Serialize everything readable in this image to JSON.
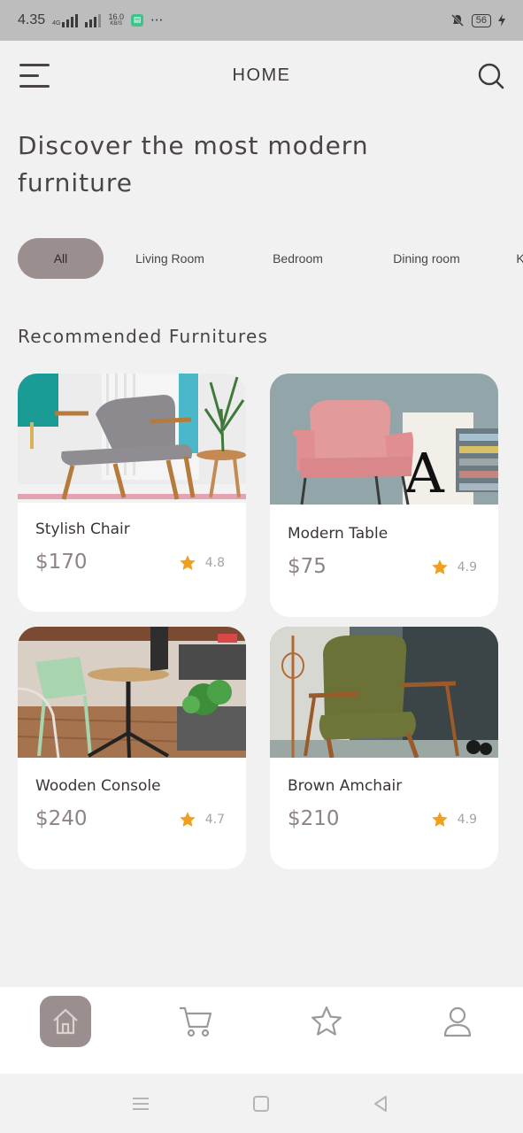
{
  "status_bar": {
    "time": "4.35",
    "network": "4G",
    "speed_value": "16.0",
    "speed_unit": "KB/S",
    "more": "···",
    "battery": "56"
  },
  "header": {
    "title": "HOME",
    "menu_icon": "hamburger-menu-icon",
    "search_icon": "search-icon"
  },
  "headline": "Discover the most modern furniture",
  "categories": [
    {
      "label": "All",
      "active": true
    },
    {
      "label": "Living Room",
      "active": false
    },
    {
      "label": "Bedroom",
      "active": false
    },
    {
      "label": "Dining room",
      "active": false
    },
    {
      "label": "K",
      "active": false
    }
  ],
  "section_title": "Recommended Furnitures",
  "products": [
    {
      "name": "Stylish Chair",
      "price": "$170",
      "rating": "4.8"
    },
    {
      "name": "Modern Table",
      "price": "$75",
      "rating": "4.9"
    },
    {
      "name": "Wooden Console",
      "price": "$240",
      "rating": "4.7"
    },
    {
      "name": "Brown Amchair",
      "price": "$210",
      "rating": "4.9"
    }
  ],
  "bottom_nav": [
    {
      "icon": "home-icon",
      "active": true
    },
    {
      "icon": "cart-icon",
      "active": false
    },
    {
      "icon": "star-icon",
      "active": false
    },
    {
      "icon": "profile-icon",
      "active": false
    }
  ],
  "colors": {
    "accent": "#9a8f8e",
    "background": "#f1f1f1",
    "card": "#ffffff",
    "star": "#f0a020",
    "text": "#4a4544"
  }
}
